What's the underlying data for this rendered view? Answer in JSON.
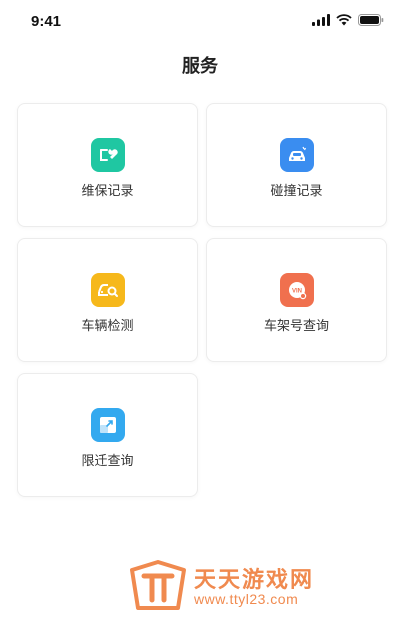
{
  "status_bar": {
    "time": "9:41"
  },
  "header": {
    "title": "服务"
  },
  "services": [
    {
      "label": "维保记录",
      "icon": "wrench-icon",
      "color": "#1fc7a2"
    },
    {
      "label": "碰撞记录",
      "icon": "car-icon",
      "color": "#3a8df0"
    },
    {
      "label": "车辆检测",
      "icon": "car-inspect-icon",
      "color": "#f6b81b"
    },
    {
      "label": "车架号查询",
      "icon": "vin-icon",
      "color": "#f0704e"
    },
    {
      "label": "限迁查询",
      "icon": "transfer-icon",
      "color": "#33a9ef"
    }
  ],
  "watermark": {
    "title": "天天游戏网",
    "url": "www.ttyl23.com",
    "color": "#f08a4f"
  }
}
